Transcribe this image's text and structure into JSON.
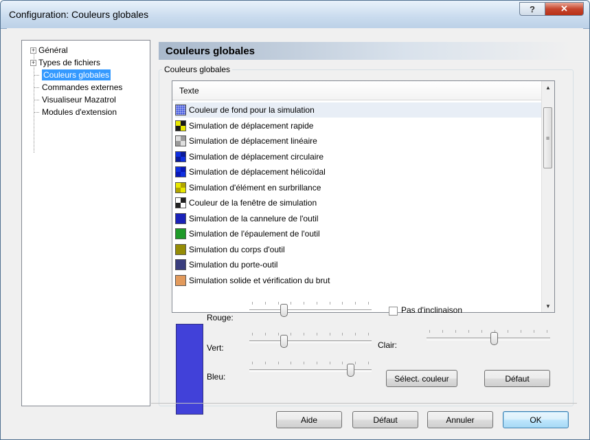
{
  "window": {
    "title": "Configuration: Couleurs globales",
    "help_glyph": "?",
    "close_glyph": "✕"
  },
  "tree": {
    "items": [
      {
        "label": "Général",
        "expandable": true
      },
      {
        "label": "Types de fichiers",
        "expandable": true
      },
      {
        "label": "Couleurs globales",
        "selected": true
      },
      {
        "label": "Commandes externes"
      },
      {
        "label": "Visualiseur Mazatrol"
      },
      {
        "label": "Modules d'extension"
      }
    ]
  },
  "panel": {
    "header": "Couleurs globales",
    "group_label": "Couleurs globales"
  },
  "list": {
    "column_header": "Texte",
    "rows": [
      {
        "label": "Couleur de fond pour la simulation",
        "swatch": "#4a5fe0",
        "pattern": "grid"
      },
      {
        "label": "Simulation de déplacement rapide",
        "swatch": "#e8e800",
        "pattern": "check-dark"
      },
      {
        "label": "Simulation de déplacement linéaire",
        "swatch": "#e0e0e0",
        "pattern": "check-grey"
      },
      {
        "label": "Simulation de déplacement circulaire",
        "swatch": "#1030e0",
        "pattern": "check-blue"
      },
      {
        "label": "Simulation de déplacement hélicoïdal",
        "swatch": "#1030e0",
        "pattern": "check-blue2"
      },
      {
        "label": "Simulation d'élément en surbrillance",
        "swatch": "#e8e800",
        "pattern": "check-yellow"
      },
      {
        "label": "Couleur de la fenêtre de simulation",
        "swatch": "#ffffff",
        "pattern": "check-bw"
      },
      {
        "label": "Simulation de la cannelure de l'outil",
        "swatch": "#1a22b8",
        "pattern": "solid"
      },
      {
        "label": "Simulation de l'épaulement de l'outil",
        "swatch": "#1f9a2a",
        "pattern": "solid"
      },
      {
        "label": "Simulation du corps d'outil",
        "swatch": "#958c06",
        "pattern": "solid"
      },
      {
        "label": "Simulation du porte-outil",
        "swatch": "#3a3e7e",
        "pattern": "solid"
      },
      {
        "label": "Simulation solide et vérification du brut",
        "swatch": "#e29a5c",
        "pattern": "solid"
      }
    ]
  },
  "color_editor": {
    "preview_color": "#4141d9",
    "red_label": "Rouge:",
    "green_label": "Vert:",
    "blue_label": "Bleu:",
    "bright_label": "Clair:",
    "red_level": 0.27,
    "green_level": 0.27,
    "blue_level": 0.85,
    "bright_level": 0.55,
    "no_tilt_label": "Pas d'inclinaison",
    "no_tilt_checked": false,
    "select_color_label": "Sélect. couleur",
    "default_label": "Défaut"
  },
  "footer": {
    "help_label": "Aide",
    "default_label": "Défaut",
    "cancel_label": "Annuler",
    "ok_label": "OK"
  }
}
